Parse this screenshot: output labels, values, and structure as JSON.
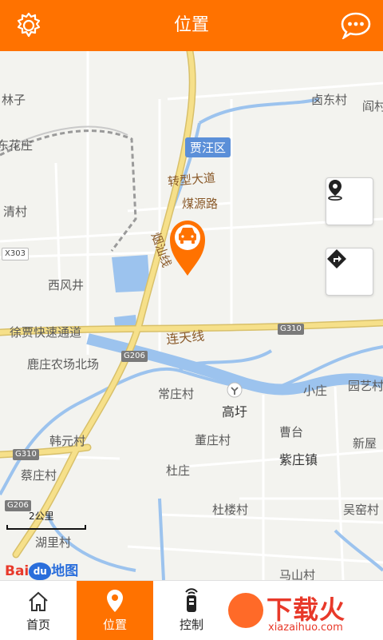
{
  "header": {
    "title": "位置",
    "settings_icon": "gear-icon",
    "message_icon": "chat-bubble-icon"
  },
  "map": {
    "district": "贾汪区",
    "labels": {
      "linzi": "林子",
      "huahuazhuang": "东花庄",
      "qingcun": "清村",
      "xifengjing": "西风井",
      "xugu_expressway": "徐贾快速通道",
      "luzhuang": "鹿庄农场北场",
      "hanyuancun": "韩元村",
      "caizhuangcun": "蔡庄村",
      "hulicun": "湖里村",
      "zhuanxing": "转型大道",
      "meiyuan": "煤源路",
      "yanshan": "烟汕线",
      "liantian": "连天线",
      "changzhuang": "常庄村",
      "gaoyu": "高圩",
      "dongzhuang": "董庄村",
      "duzhuang": "杜庄",
      "caotai": "曹台",
      "zizhuang": "紫庄镇",
      "xiaozhuang": "小庄",
      "yuanyicun": "园艺村",
      "xinwu": "新屋",
      "dulou": "杜楼村",
      "wuyao": "吴窑村",
      "mashan": "马山村",
      "maodong": "卤东村",
      "yan": "阎村",
      "road_x303": "X303",
      "road_g310a": "G310",
      "road_g310b": "G310",
      "road_g206a": "G206",
      "road_g206b": "G206"
    },
    "scale_label": "2公里",
    "logo_text": "Bai",
    "logo_du": "du",
    "logo_map": "地图",
    "buttons": {
      "locate_icon": "map-pin-icon",
      "route_icon": "directions-icon"
    }
  },
  "tabs": [
    {
      "label": "首页",
      "icon": "home-icon",
      "active": false
    },
    {
      "label": "位置",
      "icon": "location-pin-icon",
      "active": true
    },
    {
      "label": "控制",
      "icon": "remote-control-icon",
      "active": false
    }
  ],
  "watermark": {
    "main": "下载火",
    "sub": "xiazaihuo.com"
  },
  "colors": {
    "accent": "#ff7200",
    "water": "#9cc3ee",
    "highway": "#f6e08a"
  }
}
